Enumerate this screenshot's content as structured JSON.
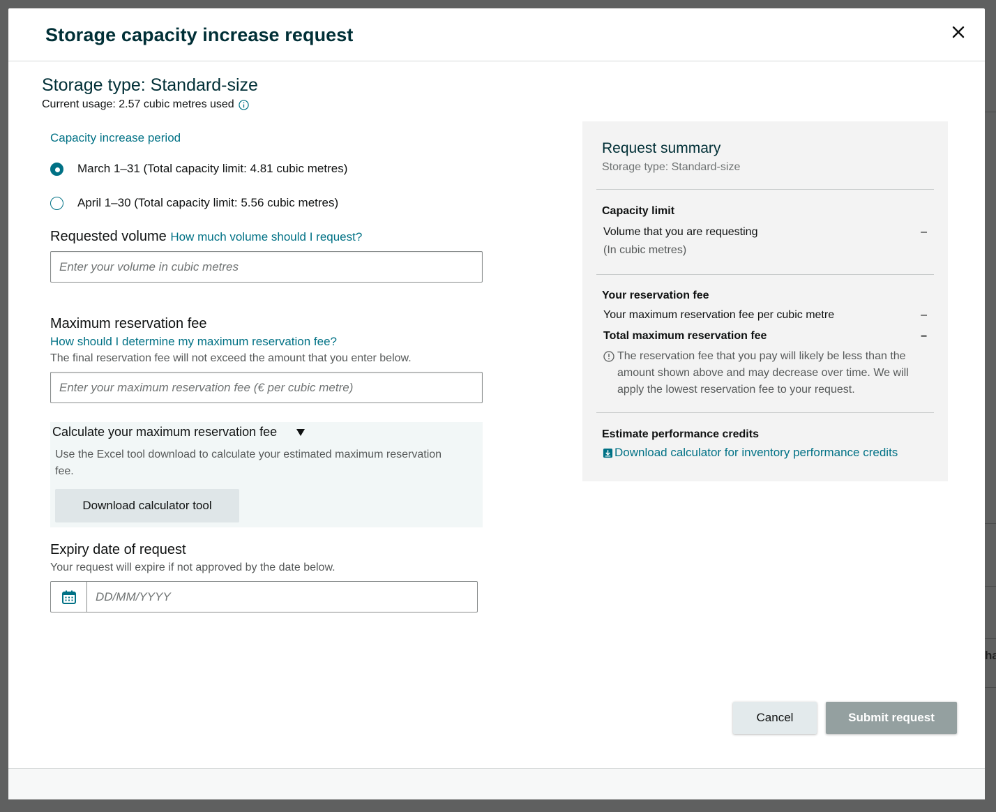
{
  "modal": {
    "title": "Storage capacity increase request"
  },
  "storage": {
    "title": "Storage type: Standard-size",
    "usage": "Current usage: 2.57 cubic metres used"
  },
  "period": {
    "label": "Capacity increase period",
    "options": [
      {
        "label": "March 1–31 (Total capacity limit: 4.81 cubic metres)",
        "selected": true
      },
      {
        "label": "April 1–30 (Total capacity limit: 5.56 cubic metres)",
        "selected": false
      }
    ]
  },
  "volume": {
    "heading": "Requested volume",
    "help_link": "How much volume should I request?",
    "placeholder": "Enter your volume in cubic metres"
  },
  "fee": {
    "heading": "Maximum reservation fee",
    "help_link": "How should I determine my maximum reservation fee?",
    "helper": "The final reservation fee will not exceed the amount that you enter below.",
    "placeholder": "Enter your maximum reservation fee (€ per cubic metre)"
  },
  "calculator": {
    "title": "Calculate your maximum reservation fee",
    "description": "Use the Excel tool download to calculate your estimated maximum reservation fee.",
    "button": "Download calculator tool"
  },
  "expiry": {
    "heading": "Expiry date of request",
    "helper": "Your request will expire if not approved by the date below.",
    "placeholder": "DD/MM/YYYY"
  },
  "summary": {
    "title": "Request summary",
    "subtitle": "Storage type: Standard-size",
    "capacity_heading": "Capacity limit",
    "volume_label": "Volume that you are requesting",
    "volume_value": "–",
    "volume_unit": "(In cubic metres)",
    "fee_heading": "Your reservation fee",
    "fee_per_label": "Your maximum reservation fee per cubic metre",
    "fee_per_value": "–",
    "fee_total_label": "Total maximum reservation fee",
    "fee_total_value": "–",
    "note": "The reservation fee that you pay will likely be less than the amount shown above and may decrease over time. We will apply the lowest reservation fee to your request.",
    "credits_heading": "Estimate performance credits",
    "credits_link": "Download calculator for inventory performance credits"
  },
  "actions": {
    "cancel": "Cancel",
    "submit": "Submit request"
  },
  "background": {
    "fragment": "ha"
  },
  "colors": {
    "accent": "#007185",
    "title": "#002f36",
    "submit_disabled": "#94a0a0"
  }
}
